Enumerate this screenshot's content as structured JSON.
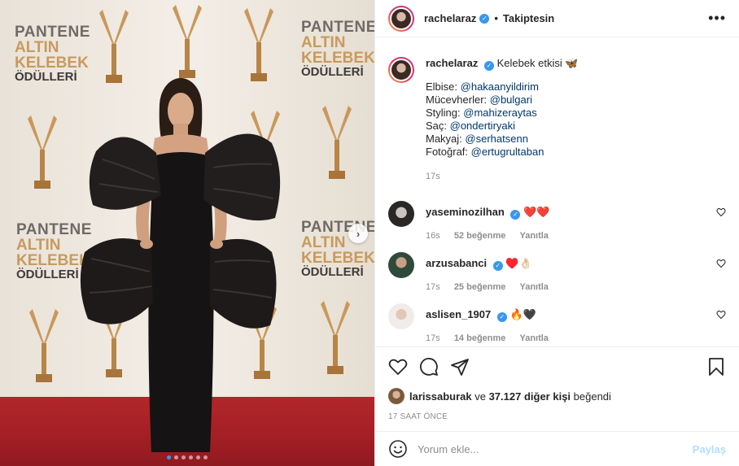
{
  "post": {
    "owner": "rachelaraz",
    "follow_status": "Takiptesin",
    "separator": "•",
    "carousel": {
      "slides": 6,
      "active_index": 0
    },
    "backdrop_logo": {
      "line1": "PANTENE",
      "line2": "ALTIN",
      "line3": "KELEBEK",
      "line4": "ÖDÜLLERİ"
    }
  },
  "caption": {
    "username": "rachelaraz",
    "text": "Kelebek etkisi 🦋",
    "lines": [
      {
        "label": "Elbise: ",
        "mention": "@hakaanyildirim"
      },
      {
        "label": "Mücevherler: ",
        "mention": "@bulgari"
      },
      {
        "label": "Styling: ",
        "mention": "@mahizeraytas"
      },
      {
        "label": "Saç: ",
        "mention": "@ondertiryaki"
      },
      {
        "label": "Makyaj: ",
        "mention": "@serhatsenn"
      },
      {
        "label": "Fotoğraf: ",
        "mention": "@ertugrultaban"
      }
    ],
    "age": "17s"
  },
  "comments": [
    {
      "username": "yaseminozilhan",
      "text": "❤️❤️",
      "age": "16s",
      "likes": "52 beğenme",
      "reply": "Yanıtla"
    },
    {
      "username": "arzusabanci",
      "text": "♥️👌🏻",
      "age": "17s",
      "likes": "25 beğenme",
      "reply": "Yanıtla"
    },
    {
      "username": "aslisen_1907",
      "text": "🔥🖤",
      "age": "17s",
      "likes": "14 beğenme",
      "reply": "Yanıtla"
    }
  ],
  "likes": {
    "user": "larissaburak",
    "middle": " ve ",
    "count": "37.127 diğer kişi",
    "suffix": " beğendi"
  },
  "timestamp": "17 SAAT ÖNCE",
  "composer": {
    "placeholder": "Yorum ekle...",
    "post_label": "Paylaş"
  },
  "icons": {
    "more": "more-options-icon",
    "like": "heart-icon",
    "comment": "comment-icon",
    "share": "share-icon",
    "save": "bookmark-icon",
    "emoji": "emoji-icon",
    "next": "chevron-right-icon"
  },
  "colors": {
    "link": "#00376b",
    "verified": "#3897f0",
    "muted": "#8e8e8e",
    "post_disabled": "#b2dffc"
  }
}
